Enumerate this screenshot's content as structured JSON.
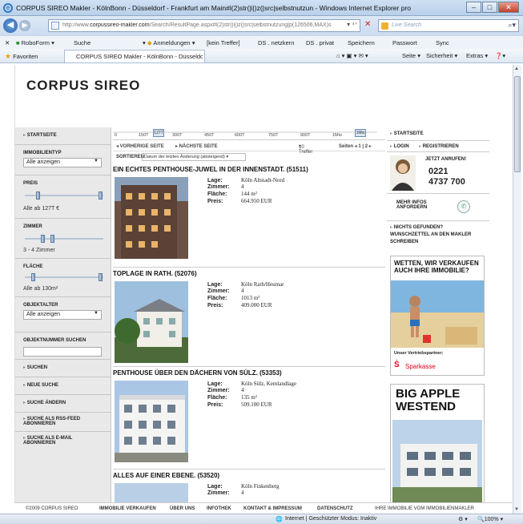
{
  "window": {
    "title": "CORPUS SIREO Makler - KölnBonn - Düsseldorf - Frankfurt am Main#l(2)str(|i|)z(|src|selbstnutzun - Windows Internet Explorer pro",
    "min": "–",
    "max": "□",
    "close": "✕"
  },
  "address": {
    "url_prefix": "http://www.",
    "url_host": "corpussireo-makler.com",
    "url_path": "/Search/ResultPage.aspx#l(2)str(|i|)z(|src|selbstnutzung|p(126506,MAX)s",
    "search_placeholder": "Live Search"
  },
  "linksbar": {
    "close": "✕",
    "roboform": "RoboForm",
    "search": "Suche",
    "anmeldungen": "Anmeldungen",
    "kein_treffer": "[kein Treffer]",
    "ds_netzkern": "DS . netzkern",
    "ds_privat": "DS . privat",
    "speichern": "Speichern",
    "passwort": "Passwort",
    "sync": "Sync"
  },
  "favbar": {
    "favoriten": "Favoriten",
    "tab_title": "CORPUS SIREO Makler - KölnBonn - Düsseldorf - ...",
    "seite": "Seite",
    "sicherheit": "Sicherheit",
    "extras": "Extras"
  },
  "logo": "CORPUS SIREO",
  "left": {
    "startseite": "STARTSEITE",
    "immobilientyp": "IMMOBILIENTYP",
    "immobilientyp_value": "Alle anzeigen",
    "preis": "PREIS",
    "preis_text": "Alle ab 127T €",
    "zimmer": "ZIMMER",
    "zimmer_text": "3 - 4 Zimmer",
    "flaeche": "FLÄCHE",
    "flaeche_text": "Alle ab 130m²",
    "objektalter": "OBJEKTALTER",
    "objektalter_value": "Alle anzeigen",
    "objektnummer": "OBJEKTNUMMER SUCHEN",
    "suchen": "SUCHEN",
    "neue_suche": "NEUE SUCHE",
    "suche_aendern": "SUCHE ÄNDERN",
    "rss": "SUCHE ALS RSS-FEED ABONNIEREN",
    "email": "SUCHE ALS E-MAIL ABONNIEREN"
  },
  "scale": {
    "ticks": [
      "0",
      "150T",
      "300T",
      "450T",
      "600T",
      "750T",
      "900T",
      "1Mio"
    ],
    "knob_left": "127T",
    "knob_right": "1Mio"
  },
  "pager": {
    "prev": "◂ VORHERIGE SEITE",
    "next": "▸ NÄCHSTE SEITE",
    "per_page": "10 Treffer",
    "pages": "Seiten  ◂ 1 | 2 ▸"
  },
  "sort": {
    "label": "SORTIEREN",
    "value": "Datum der letzten Änderung (absteigend)"
  },
  "listings": [
    {
      "title": "EIN ECHTES PENTHOUSE-JUWEL IN DER INNENSTADT. (51511)",
      "lage": "Köln Altstadt-Nord",
      "zimmer": "4",
      "flaeche": "144 m²",
      "preis": "664.950 EUR"
    },
    {
      "title": "TOPLAGE IN RATH. (52076)",
      "lage": "Köln Rath/Heumar",
      "zimmer": "4",
      "flaeche": "1013 m²",
      "preis": "409.000 EUR"
    },
    {
      "title": "PENTHOUSE ÜBER DEN DÄCHERN VON SÜLZ. (53353)",
      "lage": "Köln Sülz, Kemlandlage",
      "zimmer": "4",
      "flaeche": "135 m²",
      "preis": "509.100 EUR"
    },
    {
      "title": "ALLES AUF EINER EBENE. (53520)",
      "lage": "Köln Finkenberg",
      "zimmer": "4",
      "flaeche": "",
      "preis": ""
    }
  ],
  "labels": {
    "lage": "Lage:",
    "zimmer": "Zimmer:",
    "flaeche": "Fläche:",
    "preis": "Preis:"
  },
  "right": {
    "startseite": "STARTSEITE",
    "login": "LOGIN",
    "registrieren": "REGISTRIEREN",
    "jetzt_anrufen": "JETZT ANRUFEN!",
    "phone_1": "0221",
    "phone_2": "4737 700",
    "mehr_infos": "MEHR INFOS ANFORDERN",
    "nicht_gefunden": "NICHTS GEFUNDEN? WUNSCHZETTEL AN DEN MAKLER SCHREIBEN",
    "ad1_headline": "WETTEN, WIR VERKAUFEN AUCH IHRE IMMOBILIE?",
    "ad1_partner": "Unser Vertriebspartner:",
    "ad1_brand": "Sparkasse",
    "ad2_line1": "BIG APPLE",
    "ad2_line2": "WESTEND"
  },
  "footer": {
    "copyright": "©2009 CORPUS SIREO",
    "verkaufen": "IMMOBILIE VERKAUFEN",
    "ueber_uns": "ÜBER UNS",
    "infothek": "INFOTHEK",
    "kontakt": "KONTAKT & IMPRESSUM",
    "datenschutz": "DATENSCHUTZ",
    "ihre_immobilie": "IHRE IMMOBILIE VOM IMMOBILIENMAKLER"
  },
  "status": {
    "zone": "Internet | Geschützter Modus: Inaktiv",
    "zoom": "100%"
  },
  "colors": {
    "accent_blue": "#2b78c5",
    "sparkasse_red": "#e3001b",
    "sidebar_grey": "#e9e9e9"
  }
}
